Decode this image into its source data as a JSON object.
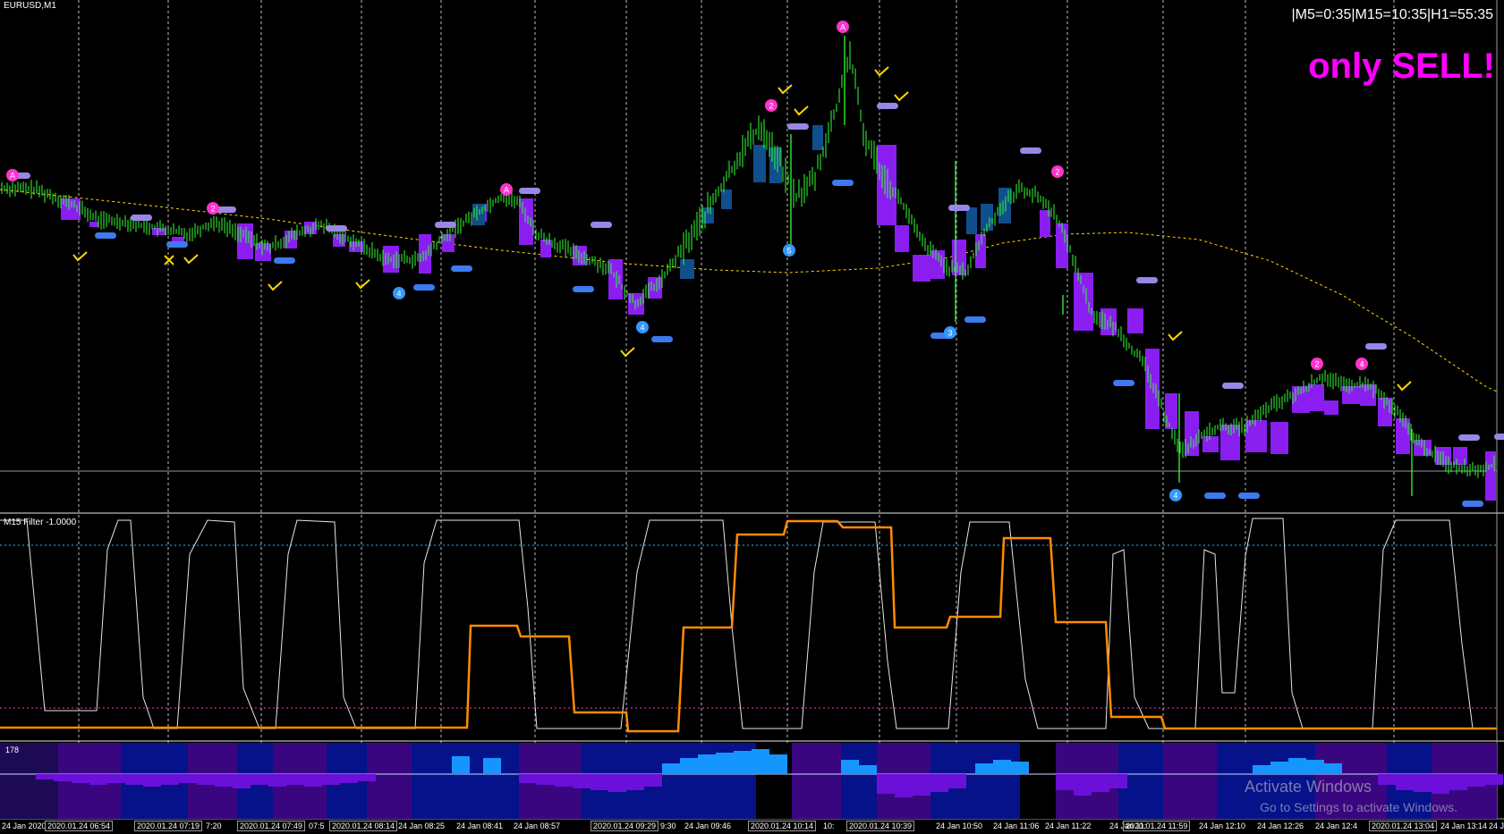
{
  "symbol_label": "EURUSD,M1",
  "timers": "|M5=0:35|M15=10:35|H1=55:35",
  "signal_text": "only SELL!",
  "filter_label": "M15 Filter -1.0000",
  "hist_label": "178",
  "windows_watermark": {
    "title": "Activate Windows",
    "subtitle": "Go to Settings to activate Windows."
  },
  "time_axis": [
    {
      "label": "24 Jan 2020",
      "boxed": false
    },
    {
      "label": "2020.01.24 06:54",
      "boxed": true
    },
    {
      "label": "2020.01.24 07:19",
      "boxed": true
    },
    {
      "label": "7:20",
      "boxed": false
    },
    {
      "label": "2020.01.24 07:49",
      "boxed": true
    },
    {
      "label": "07:5",
      "boxed": false
    },
    {
      "label": "2020.01.24 08:14",
      "boxed": true
    },
    {
      "label": "24 Jan 08:25",
      "boxed": false
    },
    {
      "label": "24 Jan 08:41",
      "boxed": false
    },
    {
      "label": "24 Jan 08:57",
      "boxed": false
    },
    {
      "label": "2020.01.24 09:29",
      "boxed": true
    },
    {
      "label": "9:30",
      "boxed": false
    },
    {
      "label": "24 Jan 09:46",
      "boxed": false
    },
    {
      "label": "2020.01.24 10:14",
      "boxed": true
    },
    {
      "label": "10:",
      "boxed": false
    },
    {
      "label": "2020.01.24 10:39",
      "boxed": true
    },
    {
      "label": "24 Jan 10:50",
      "boxed": false
    },
    {
      "label": "24 Jan 11:06",
      "boxed": false
    },
    {
      "label": "24 Jan 11:22",
      "boxed": false
    },
    {
      "label": "24 Jan 11:",
      "boxed": false
    },
    {
      "label": "2020.01.24 11:59",
      "boxed": true
    },
    {
      "label": "24 Jan 12:10",
      "boxed": false
    },
    {
      "label": "24 Jan 12:26",
      "boxed": false
    },
    {
      "label": "24 Jan 12:4",
      "boxed": false
    },
    {
      "label": "2020.01.24 13:04",
      "boxed": true
    },
    {
      "label": "24 Jan 13:14",
      "boxed": false
    },
    {
      "label": "24 Ja",
      "boxed": false
    }
  ],
  "markers": {
    "sell": [
      "A",
      "2",
      "A",
      "2",
      "A",
      "2",
      "2",
      "4"
    ],
    "buy": [
      "4",
      "4",
      "5",
      "3",
      "4"
    ]
  },
  "colors": {
    "background": "#000000",
    "candle": "#33ff33",
    "box_bear": "#8a1ef0",
    "box_bull": "#114e8c",
    "dash_light": "#9a86e6",
    "dash_blue": "#3d7af0",
    "ma": "#ffd700",
    "signal_text": "#ff00ff",
    "sell_marker": "#ff33cc",
    "buy_marker": "#3399ff",
    "white_line": "#e6e6e6",
    "orange_line": "#ff8c00",
    "hist_dark_purple": "#3a0680",
    "hist_navy": "#05128a",
    "hist_violet": "#6a10d8",
    "hist_cyan": "#1596ff"
  }
}
